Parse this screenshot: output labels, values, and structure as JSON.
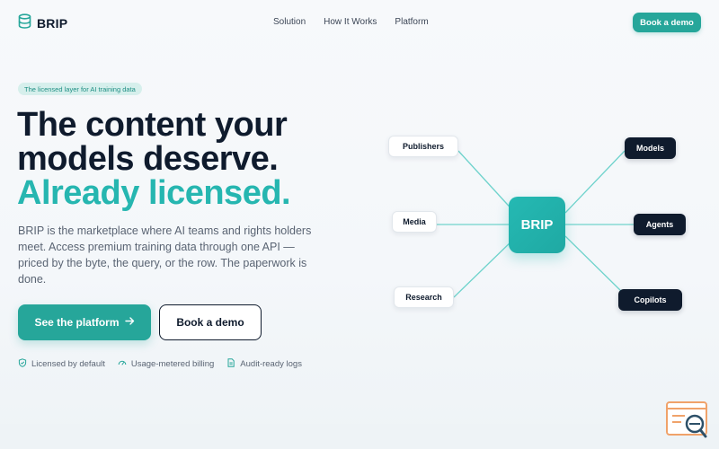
{
  "brand": {
    "name": "BRIP",
    "accent": "#26a69a",
    "dark": "#0f1b2d"
  },
  "nav": {
    "items": [
      "Solution",
      "How It Works",
      "Platform"
    ]
  },
  "header": {
    "cta_label": "Book a demo"
  },
  "hero": {
    "badge": "The licensed layer for AI training data",
    "headline_line1": "The content your",
    "headline_line2": "models deserve.",
    "headline_accent": "Already licensed.",
    "description": "BRIP is the marketplace where AI teams and rights holders meet. Access premium training data through one API — priced by the byte, the query, or the row. The paperwork is done.",
    "primary_label": "See the platform",
    "secondary_label": "Book a demo",
    "features": [
      {
        "icon": "shield-check-icon",
        "label": "Licensed by default"
      },
      {
        "icon": "gauge-icon",
        "label": "Usage-metered billing"
      },
      {
        "icon": "document-icon",
        "label": "Audit-ready logs"
      }
    ]
  },
  "diagram": {
    "hub": "BRIP",
    "sources": [
      "Publishers",
      "Media",
      "Research"
    ],
    "destinations": [
      "Models",
      "Agents",
      "Copilots"
    ]
  }
}
